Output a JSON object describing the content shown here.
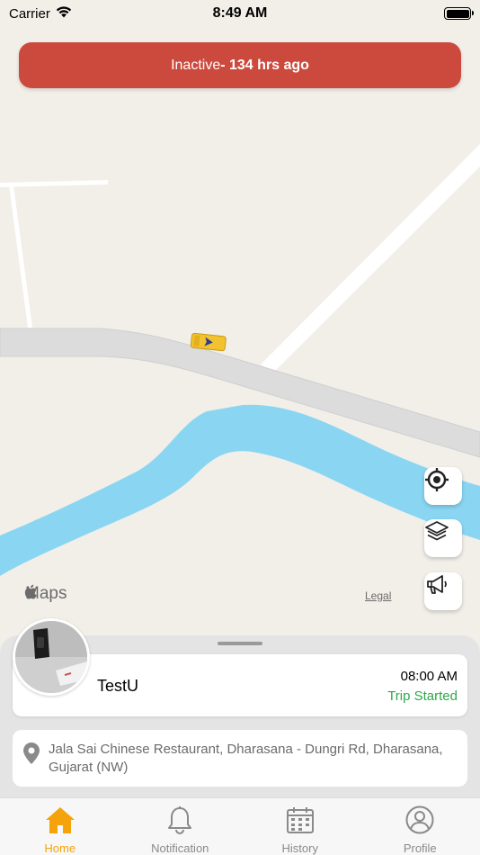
{
  "status_bar": {
    "carrier": "Carrier",
    "time": "8:49 AM"
  },
  "banner": {
    "status": "Inactive",
    "duration": " - 134 hrs ago"
  },
  "map": {
    "maps_brand": "Maps",
    "legal": "Legal",
    "buttons": [
      {
        "name": "locate-button",
        "icon": "crosshair-icon"
      },
      {
        "name": "layers-button",
        "icon": "layers-icon"
      },
      {
        "name": "announce-button",
        "icon": "megaphone-icon"
      }
    ]
  },
  "trip": {
    "driver_name": "TestU",
    "time": "08:00 AM",
    "status": "Trip Started"
  },
  "address": {
    "line": "Jala Sai Chinese Restaurant, Dharasana - Dungri Rd, Dharasana, Gujarat (NW)"
  },
  "tabs": [
    {
      "label": "Home",
      "icon": "home-icon",
      "active": true
    },
    {
      "label": "Notification",
      "icon": "bell-icon",
      "active": false
    },
    {
      "label": "History",
      "icon": "calendar-icon",
      "active": false
    },
    {
      "label": "Profile",
      "icon": "user-icon",
      "active": false
    }
  ],
  "colors": {
    "banner": "#cc4a3d",
    "active_tab": "#f5a30a",
    "trip_status": "#2fa84a",
    "water": "#8ad6f2"
  }
}
